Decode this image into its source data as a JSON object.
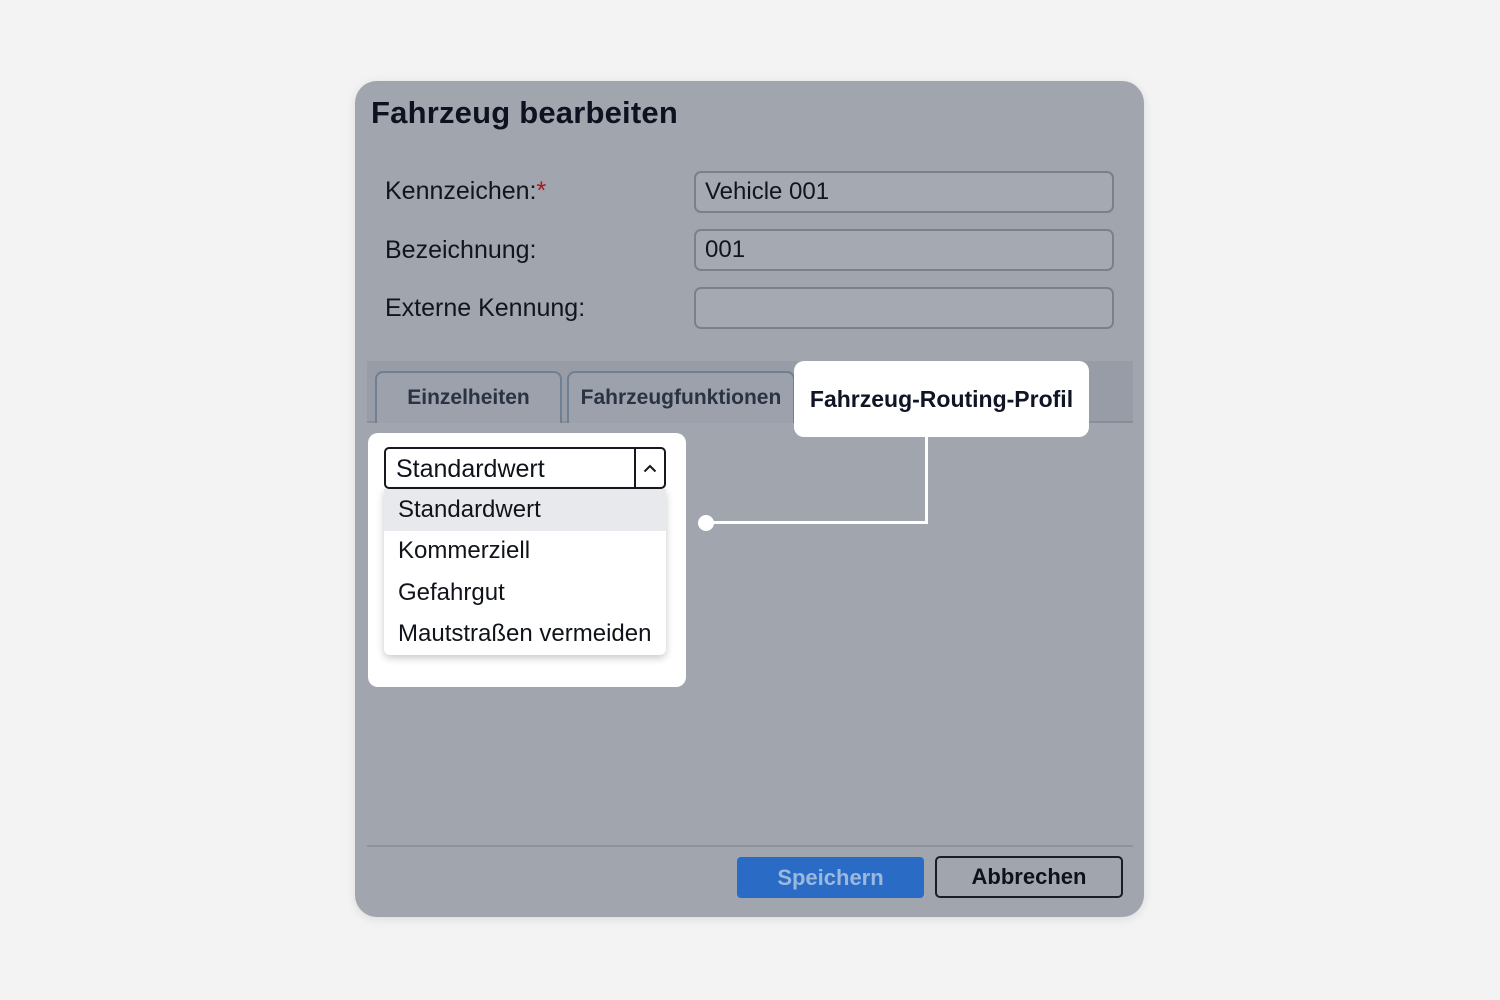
{
  "dialog": {
    "title": "Fahrzeug bearbeiten",
    "fields": [
      {
        "label": "Kennzeichen:",
        "required_mark": "*",
        "value": "Vehicle 001"
      },
      {
        "label": "Bezeichnung:",
        "value": "001"
      },
      {
        "label": "Externe Kennung:",
        "value": ""
      }
    ],
    "tabs": [
      {
        "label": "Einzelheiten"
      },
      {
        "label": "Fahrzeugfunktionen"
      },
      {
        "label": "Fahrzeug-Routing-Profil"
      }
    ],
    "routing_profile": {
      "selected": "Standardwert",
      "options": [
        "Standardwert",
        "Kommerziell",
        "Gefahrgut",
        "Mautstraßen vermeiden"
      ]
    },
    "buttons": {
      "save": "Speichern",
      "cancel": "Abbrechen"
    }
  },
  "colors": {
    "overlay_dialog": "#a1a5ae",
    "page_background": "#f3f3f4",
    "required": "#b3141a",
    "primary_button": "#2a6bc5",
    "callout": "#ffffff"
  },
  "icons": {
    "select_toggle": "chevron-up-icon"
  }
}
